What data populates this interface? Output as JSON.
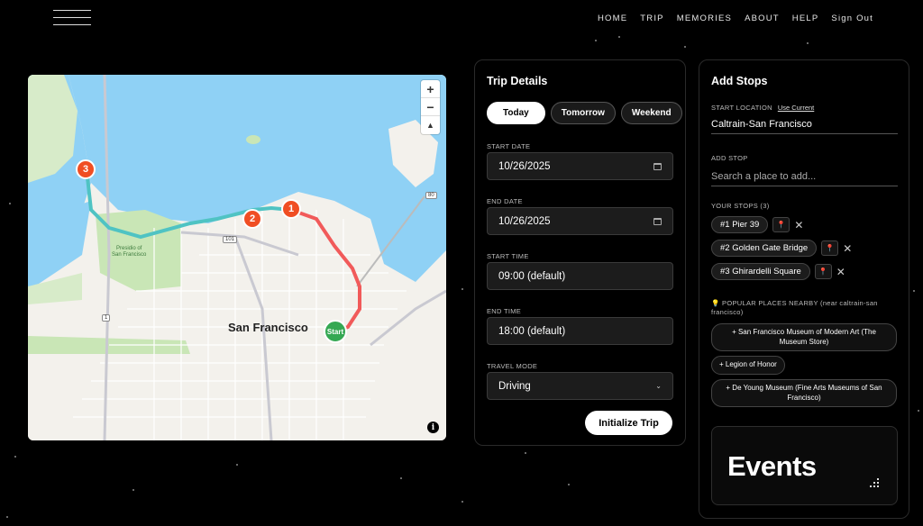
{
  "nav": {
    "menu_icon": "hamburger-icon",
    "links": [
      "HOME",
      "TRIP",
      "MEMORIES",
      "ABOUT",
      "HELP",
      "Sign Out"
    ]
  },
  "map": {
    "city": "San Francisco",
    "park": "Presidio of\nSan Francisco",
    "shields": [
      "101",
      "1",
      "80"
    ],
    "markers": [
      "3",
      "2",
      "1",
      "Start"
    ],
    "zoom_in": "+",
    "zoom_out": "−",
    "compass": "▲",
    "info": "i",
    "colors": {
      "water": "#8fd1f5",
      "park": "#c9e6b6",
      "route_teal": "#4fc3c3",
      "route_red": "#f15a5a"
    }
  },
  "trip": {
    "title": "Trip Details",
    "quick": [
      "Today",
      "Tomorrow",
      "Weekend"
    ],
    "start_date_label": "START DATE",
    "start_date": "10/26/2025",
    "end_date_label": "END DATE",
    "end_date": "10/26/2025",
    "start_time_label": "START TIME",
    "start_time": "09:00 (default)",
    "end_time_label": "END TIME",
    "end_time": "18:00 (default)",
    "mode_label": "TRAVEL MODE",
    "mode": "Driving",
    "init": "Initialize Trip"
  },
  "stops": {
    "title": "Add Stops",
    "start_label": "START LOCATION",
    "use_current": "Use Current",
    "start_value": "Caltrain-San Francisco",
    "add_label": "ADD STOP",
    "add_placeholder": "Search a place to add...",
    "your_stops_label": "YOUR STOPS (3)",
    "list": [
      "#1 Pier 39",
      "#2 Golden Gate Bridge",
      "#3 Ghirardelli Square"
    ],
    "popular_label": "💡 POPULAR PLACES NEARBY (near caltrain-san francisco)",
    "popular": [
      "+ San Francisco Museum of Modern Art (The Museum Store)",
      "+ Legion of Honor",
      "+ De Young Museum (Fine Arts Museums of San Francisco)"
    ],
    "events": "Events"
  }
}
